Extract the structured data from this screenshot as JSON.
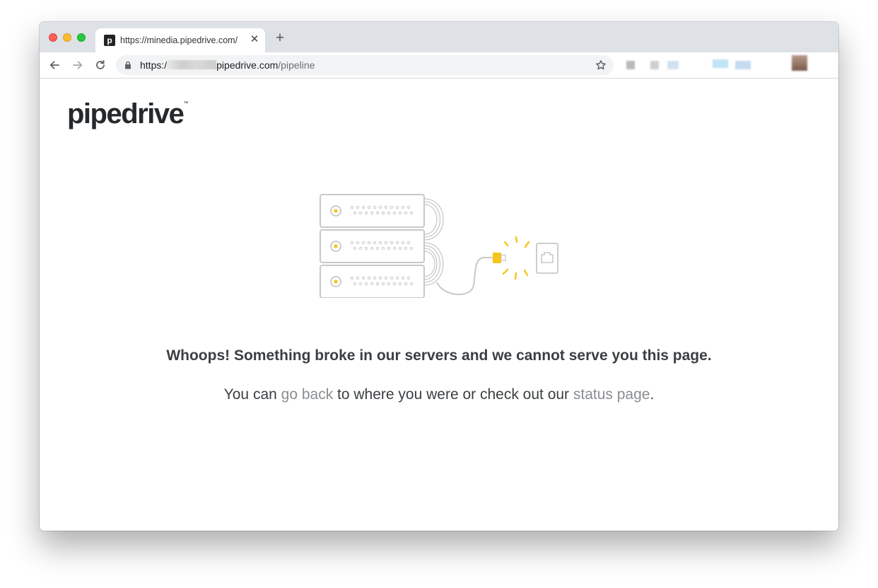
{
  "browser": {
    "tab": {
      "favicon_letter": "p",
      "title": "https://minedia.pipedrive.com/",
      "close_glyph": "✕"
    },
    "new_tab_glyph": "+",
    "url": {
      "scheme": "https:/",
      "host_tail": "pipedrive.com",
      "path": "/pipeline"
    },
    "icons": {
      "back": "arrow-left-icon",
      "forward": "arrow-right-icon",
      "reload": "reload-icon",
      "lock": "lock-icon",
      "bookmark": "star-icon"
    }
  },
  "page": {
    "logo": "pipedrive",
    "logo_tm": "™",
    "headline": "Whoops! Something broke in our servers and we cannot serve you this page.",
    "sub": {
      "before": "You can ",
      "link1": "go back",
      "middle": " to where you were or check out our ",
      "link2": "status page",
      "after": "."
    }
  },
  "colors": {
    "accent_yellow": "#f5c518",
    "illustration_gray": "#c8c8c8",
    "link_gray": "#8a8e91",
    "text_dark": "#3b3f42"
  }
}
